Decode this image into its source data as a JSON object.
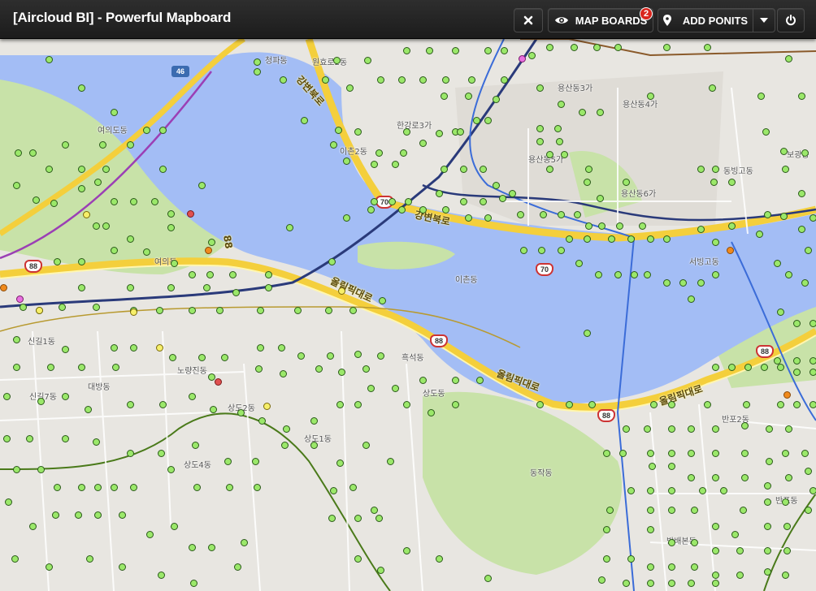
{
  "header": {
    "title": "[Aircloud BI] - Powerful Mapboard",
    "close_icon": "close-x-icon",
    "map_boards_label": "MAP BOARDS",
    "map_boards_icon": "eye-icon",
    "map_boards_badge": "2",
    "add_points_label": "ADD PONITS",
    "add_points_icon": "map-pin-icon",
    "caret_icon": "caret-down-icon",
    "power_icon": "power-icon"
  },
  "colors": {
    "river": "#a3bdf5",
    "land": "#e8e6e1",
    "park": "#c8e2a8",
    "highway": "#f4cf3c",
    "marker_green": "#9be86a",
    "marker_red": "#e05050",
    "marker_orange": "#f08a1c",
    "marker_yellow": "#f6ef6a",
    "marker_pink": "#e870e0"
  },
  "map": {
    "place_labels": {
      "yeouido_dong": "여의도동",
      "yeoui_dong": "여의동",
      "hangangno3ga": "한강로3가",
      "ichon_dong": "이촌동",
      "ichon2_dong": "이촌2동",
      "yongsan_dong3ga": "용산동3가",
      "yongsan_dong4ga": "용산동4가",
      "yongsan_dong5ga": "용산동5가",
      "yongsan_dong6ga": "용산동6가",
      "dongbinggo_dong": "동빙고동",
      "seobinggo_dong": "서빙고동",
      "heukseok_dong": "흑석동",
      "noryangjin_dong": "노량진동",
      "sangdo_dong": "상도동",
      "sangdo1_dong": "상도1동",
      "sangdo4_dong": "상도4동",
      "sangdo2_dong": "상도2동",
      "daebang_dong": "대방동",
      "singil1_dong": "신길1동",
      "singil7_dong": "신길7동",
      "dongjak_dong": "동작동",
      "banpo2_dong": "반포2동",
      "banpo_dong": "반포동",
      "bangbaebon_dong": "방배본동",
      "bogwang_dong": "보광동",
      "cheongpa_dong": "청파동",
      "wonhyoro2_dong": "원효로2동"
    },
    "road_labels": {
      "gangbyeonbukro_1": "강변북로",
      "gangbyeonbukro_2": "강변북로",
      "olympic_daero_1": "올림픽대로",
      "olympic_daero_2": "올림픽대로",
      "olympic_daero_3": "올림픽대로",
      "route_88": "88"
    },
    "shields": {
      "route46": "46",
      "route70a": "70",
      "route70b": "70",
      "route88a": "88",
      "route88b": "88",
      "route88c": "88",
      "route88d": "88"
    }
  }
}
